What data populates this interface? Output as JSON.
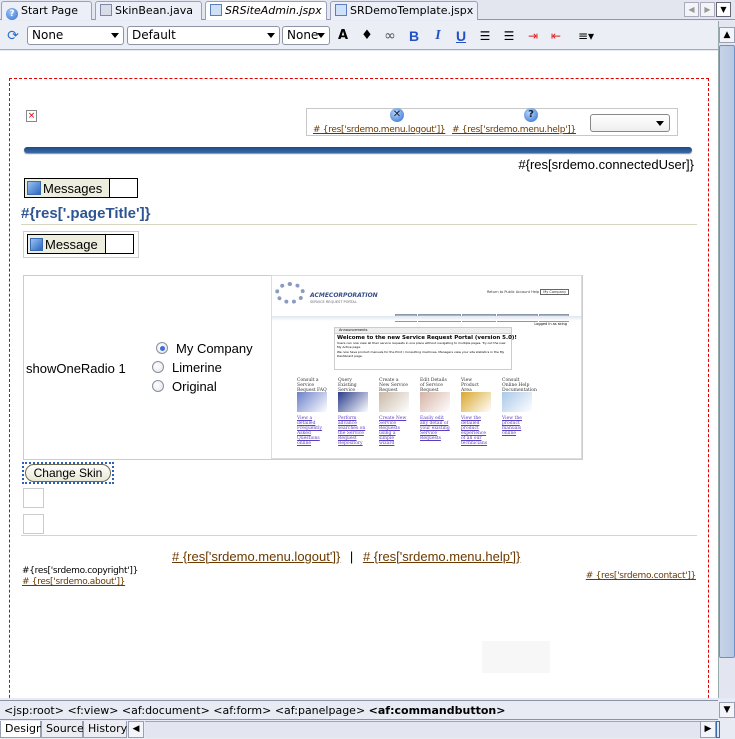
{
  "tabs": [
    {
      "label": "Start Page",
      "icon": "help-circle-icon",
      "active": false,
      "italic": false
    },
    {
      "label": "SkinBean.java",
      "icon": "java-file-icon",
      "active": false,
      "italic": false
    },
    {
      "label": "SRSiteAdmin.jspx",
      "icon": "jspx-file-icon",
      "active": true,
      "italic": true
    },
    {
      "label": "SRDemoTemplate.jspx",
      "icon": "jspx-file-icon",
      "active": false,
      "italic": false
    }
  ],
  "toolbar": {
    "style_select": "None",
    "font_select": "Default",
    "size_select": "None",
    "buttons": [
      "text-color",
      "fill-color",
      "link",
      "bold",
      "italic",
      "underline",
      "ordered-list",
      "unordered-list",
      "indent",
      "outdent",
      "align"
    ]
  },
  "page": {
    "logout_link": "# {res['srdemo.menu.logout']}",
    "help_link": "# {res['srdemo.menu.help']}",
    "connected_user": "#{res[srdemo.connectedUser]}",
    "messages_label": "Messages",
    "page_title": "#{res['.pageTitle']}",
    "message_label": "Message",
    "radio_label": "showOneRadio 1",
    "radio_options": [
      {
        "label": "My Company",
        "selected": true
      },
      {
        "label": "Limerine",
        "selected": false
      },
      {
        "label": "Original",
        "selected": false
      }
    ],
    "change_skin_button": "Change Skin",
    "footer_logout": "# {res['srdemo.menu.logout']}",
    "footer_separator": "|",
    "footer_help": "# {res['srdemo.menu.help']}",
    "copyright": "#{res['srdemo.copyright']}",
    "about_link": "# {res['srdemo.about']}",
    "contact_link": "# {res['srdemo.contact']}"
  },
  "preview": {
    "logo": "ACMECORPORATION",
    "logo_sub": "SERVICE REQUEST PORTAL",
    "top_links": [
      "Return to Public Account",
      "Help"
    ],
    "top_select": "My Company",
    "nav_tabs": [
      "My Active",
      "My Service Requests",
      "Advanced Search",
      "New Service Request",
      "Management"
    ],
    "logged_in": "Logged in as sking",
    "box_header": "Announcements",
    "welcome": "Welcome to the new Service Request Portal (version 5.0)!",
    "welcome_text1": "Users can now view all their service requests in one place without navigating to multiple pages. Try out the new My Active page.",
    "welcome_text2": "We now have product manuals for the Print / Consulting machines. Managers view your site statistics in the My Dashboard page.",
    "columns": [
      {
        "head": "Consult a Service Request FAQ",
        "link": "View a detailed Frequently Asked Questions online",
        "color": "#6a7fc9"
      },
      {
        "head": "Query Existing Service Requests",
        "link": "Perform advance searches on the Service Request Repository",
        "color": "#2a3d8c"
      },
      {
        "head": "Create a New Service Request",
        "link": "Create New Service Requests using a simple wizard",
        "color": "#c9b9a8"
      },
      {
        "head": "Edit Details of Service Request",
        "link": "Easily edit any detail of your existing Service Requests",
        "color": "#d6b3a6"
      },
      {
        "head": "View Product Area Expertise",
        "link": "View the detailed product experience of all our technicians",
        "color": "#d9a72a"
      },
      {
        "head": "Consult Online Help Documentation",
        "link": "View the product manuals online",
        "color": "#a9c8e8"
      }
    ]
  },
  "breadcrumb": {
    "items": [
      "<jsp:root>",
      "<f:view>",
      "<af:document>",
      "<af:form>",
      "<af:panelpage>"
    ],
    "current": "<af:commandbutton>"
  },
  "bottom_tabs": [
    {
      "label": "Design",
      "active": true
    },
    {
      "label": "Source",
      "active": false
    },
    {
      "label": "History",
      "active": false
    }
  ],
  "colors": {
    "link": "#6b3a00",
    "title_blue": "#2e5591",
    "bar_blue": "#2b5a97",
    "dashed_border": "#e00000",
    "focus_ring": "#2d5fbf"
  }
}
